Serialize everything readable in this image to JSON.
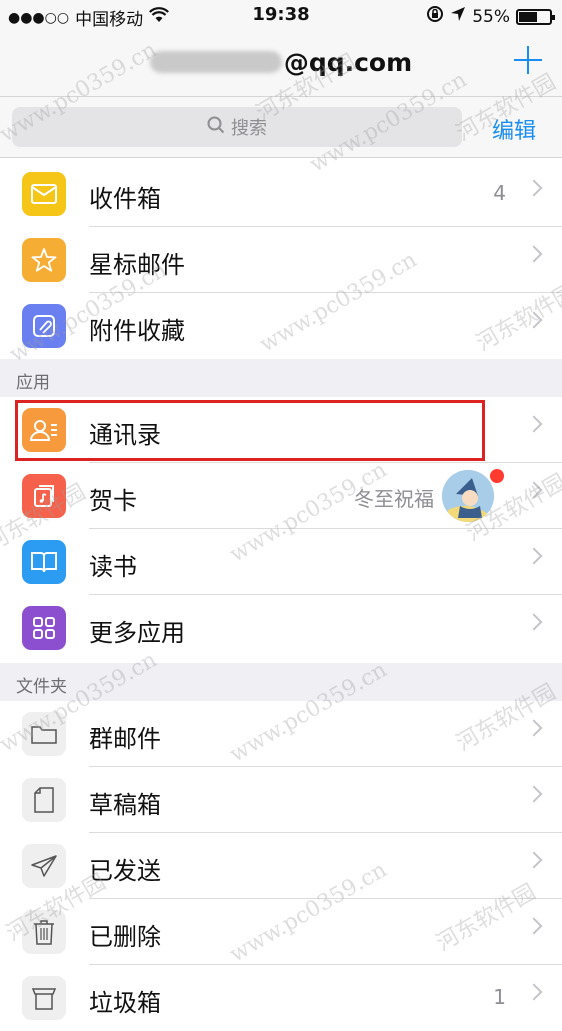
{
  "status_bar": {
    "signal": "●●●○○",
    "carrier": "中国移动",
    "time": "19:38",
    "battery_percent": "55%",
    "battery_level": 0.55
  },
  "nav": {
    "account_visible": "@qq.com",
    "compose_icon": "plus-icon"
  },
  "search": {
    "placeholder": "搜索",
    "edit_label": "编辑"
  },
  "mailboxes": [
    {
      "label": "收件箱",
      "icon": "inbox-icon",
      "count": "4",
      "color": "#f5c518"
    },
    {
      "label": "星标邮件",
      "icon": "star-icon",
      "count": "",
      "color": "#f6ad34"
    },
    {
      "label": "附件收藏",
      "icon": "attachment-icon",
      "count": "",
      "color": "#6a7ff0"
    }
  ],
  "apps_section": {
    "title": "应用",
    "items": [
      {
        "label": "通讯录",
        "icon": "contacts-icon",
        "color": "#f79a3e"
      },
      {
        "label": "贺卡",
        "icon": "card-icon",
        "color": "#f5614a",
        "hint": "冬至祝福"
      },
      {
        "label": "读书",
        "icon": "book-icon",
        "color": "#2c9cf2"
      },
      {
        "label": "更多应用",
        "icon": "apps-grid-icon",
        "color": "#8b4fd0"
      }
    ]
  },
  "folders_section": {
    "title": "文件夹",
    "items": [
      {
        "label": "群邮件",
        "icon": "folder-icon"
      },
      {
        "label": "草稿箱",
        "icon": "draft-icon"
      },
      {
        "label": "已发送",
        "icon": "sent-icon"
      },
      {
        "label": "已删除",
        "icon": "trash-icon"
      },
      {
        "label": "垃圾箱",
        "icon": "junk-icon",
        "count": "1"
      }
    ]
  },
  "watermark_text_1": "河东软件园",
  "watermark_text_2": "www.pc0359.cn"
}
